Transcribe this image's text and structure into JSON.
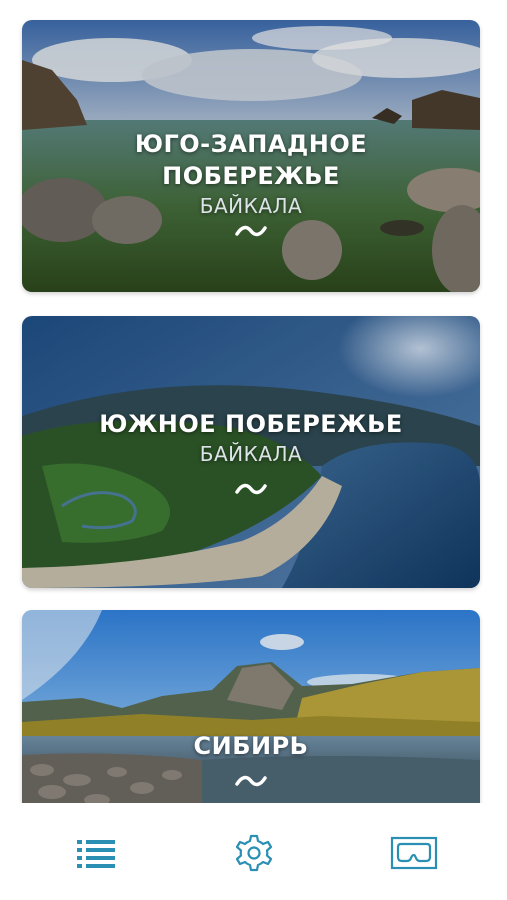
{
  "cards": [
    {
      "title": "ЮГО-ЗАПАДНОЕ",
      "title2": "ПОБЕРЕЖЬЕ",
      "subtitle": "БАЙКАЛА"
    },
    {
      "title": "ЮЖНОЕ ПОБЕРЕЖЬЕ",
      "subtitle": "БАЙКАЛА"
    },
    {
      "title": "СИБИРЬ"
    }
  ],
  "tabbar": {
    "items": [
      {
        "icon": "list-icon"
      },
      {
        "icon": "gear-icon"
      },
      {
        "icon": "vr-headset-icon"
      }
    ]
  },
  "colors": {
    "accent": "#2a8fb2",
    "background": "#ffffff"
  }
}
